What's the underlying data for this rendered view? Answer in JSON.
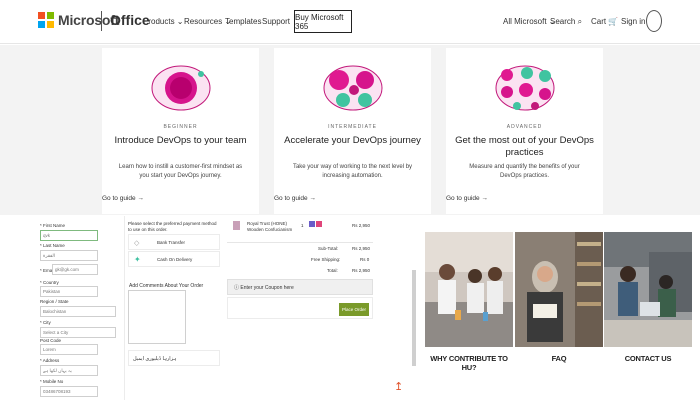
{
  "header": {
    "brand": "Microsoft",
    "product": "Office",
    "nav": [
      "Products",
      "Resources",
      "Templates",
      "Support"
    ],
    "buy_button": "Buy Microsoft 365",
    "all_microsoft": "All Microsoft",
    "search": "Search",
    "cart": "Cart",
    "signin": "Sign in",
    "logo_colors": [
      "#f25022",
      "#7fba00",
      "#00a4ef",
      "#ffb900"
    ]
  },
  "cards": [
    {
      "tag": "BEGINNER",
      "title": "Introduce DevOps to your team",
      "desc": "Learn how to instill a customer-first mindset as you start your DevOps journey.",
      "link": "Go to guide →"
    },
    {
      "tag": "INTERMEDIATE",
      "title": "Accelerate your DevOps journey",
      "desc": "Take your way of working to the next level by increasing automation.",
      "link": "Go to guide →"
    },
    {
      "tag": "ADVANCED",
      "title": "Get the most out of your DevOps practices",
      "desc": "Measure and quantify the benefits of your DevOps practices.",
      "link": "Go to guide →"
    }
  ],
  "form": {
    "first_name_label": "* First Name",
    "first_name_value": "qvk",
    "last_name_label": "* Last Name",
    "last_name_value": "الفقرة",
    "email_label": "* Email",
    "email_value": "gk@gk.com",
    "country_label": "* Country",
    "country_value": "Pakistan",
    "region_label": "Region / State",
    "region_value": "Balochistan",
    "city_label": "* City",
    "city_value": "Select a City",
    "postcode_label": "Post Code",
    "postcode_value": "Lorem",
    "address_label": "* Address",
    "address_value": "یہ یہاں لکھا ہے",
    "mobile_label": "* Mobile No",
    "mobile_value": "03486708193"
  },
  "shipping": {
    "intro": "Please select the preferred payment method to use on this order.",
    "option1": "Bank Transfer",
    "option2": "Cash On Delivery",
    "comment_label": "Add Comments About Your Order",
    "note": "ہزارہا ڈیلیوری ایمیل"
  },
  "summary": {
    "product": "Royal Trust (HONE) Wooden Confucianism",
    "qty": "1",
    "price": "Rs 2,950",
    "subtotal_label": "Sub-Total:",
    "subtotal": "Rs 2,950",
    "shipping_label": "Free Shipping:",
    "shipping": "Rs 0",
    "total_label": "Total:",
    "total": "Rs 2,950",
    "coupon": "Enter your Coupon here",
    "place_order": "Place Order"
  },
  "tiles": [
    {
      "caption": "WHY CONTRIBUTE TO HU?"
    },
    {
      "caption": "FAQ"
    },
    {
      "caption": "CONTACT US"
    }
  ]
}
